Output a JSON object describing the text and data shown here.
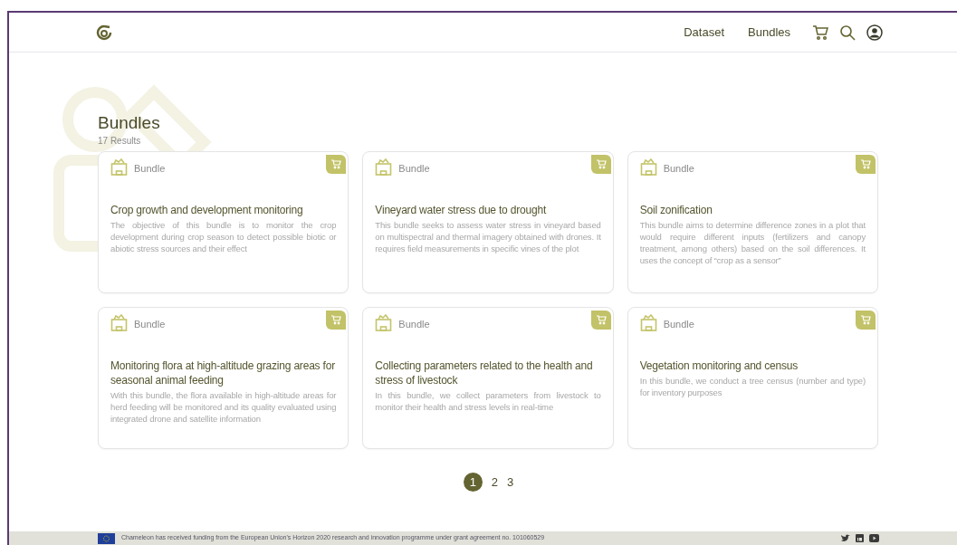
{
  "nav": {
    "links": [
      "Dataset",
      "Bundles"
    ]
  },
  "heading": {
    "title": "Bundles",
    "count": "17 Results"
  },
  "bundles": [
    {
      "type": "Bundle",
      "title": "Crop growth and development monitoring",
      "description": "The objective of this bundle is to monitor the crop development during crop season to detect possible biotic or abiotic stress sources and their effect"
    },
    {
      "type": "Bundle",
      "title": "Vineyard water stress due to drought",
      "description": "This bundle seeks to assess water stress in vineyard based on multispectral and thermal imagery obtained with drones. It requires field measurements in specific vines of the plot"
    },
    {
      "type": "Bundle",
      "title": "Soil zonification",
      "description": "This bundle aims to determine difference zones in a plot that would require different inputs (fertilizers and canopy treatment, among others) based on the soil differences. It uses the concept of “crop as a sensor”"
    },
    {
      "type": "Bundle",
      "title": "Monitoring flora at high-altitude grazing areas for seasonal animal feeding",
      "description": "With this bundle, the flora available in high-altitude areas for herd feeding will be monitored and its quality evaluated using integrated drone and satellite information"
    },
    {
      "type": "Bundle",
      "title": "Collecting parameters related to the health and stress of livestock",
      "description": "In this bundle, we collect parameters from livestock to monitor their health and stress levels in real-time"
    },
    {
      "type": "Bundle",
      "title": "Vegetation monitoring and census",
      "description": "In this bundle, we conduct a tree census (number and type) for inventory purposes"
    }
  ],
  "pagination": [
    {
      "label": "1",
      "selected": true
    },
    {
      "label": "2",
      "selected": false
    },
    {
      "label": "3",
      "selected": false
    }
  ],
  "footer": {
    "funding_text": "Chameleon has received funding from the European Union's Horizon 2020 research and innovation programme under grant agreement no. 101060529"
  }
}
